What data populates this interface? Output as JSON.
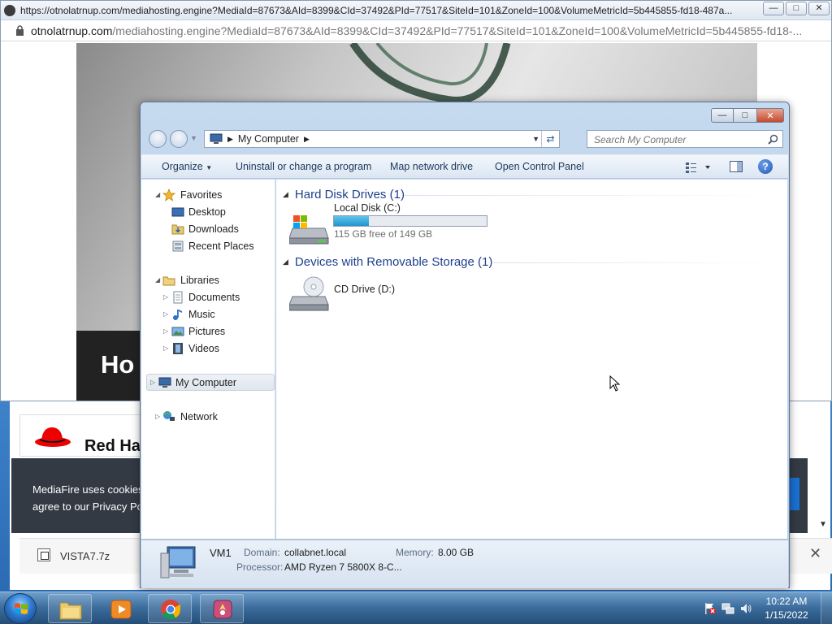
{
  "popup": {
    "title": "https://otnolatrnup.com/mediahosting.engine?MediaId=87673&AId=8399&CId=37492&PId=77517&SiteId=101&ZoneId=100&VolumeMetricId=5b445855-fd18-487a...",
    "url_host": "otnolatrnup.com",
    "url_rest": "/mediahosting.engine?MediaId=87673&AId=8399&CId=37492&PId=77517&SiteId=101&ZoneId=100&VolumeMetricId=5b445855-fd18-...",
    "banner_text": "Ho"
  },
  "underpage": {
    "redhat_text": "Red Ha",
    "cookie_line1": "MediaFire uses cookies",
    "cookie_line2": "agree to our Privacy Po",
    "download_name": "VISTA7.7z"
  },
  "explorer": {
    "address": "My Computer",
    "search_placeholder": "Search My Computer",
    "toolbar": {
      "organize": "Organize",
      "uninstall": "Uninstall or change a program",
      "map_drive": "Map network drive",
      "control_panel": "Open Control Panel"
    },
    "nav": {
      "favorites": "Favorites",
      "desktop": "Desktop",
      "downloads": "Downloads",
      "recent": "Recent Places",
      "libraries": "Libraries",
      "documents": "Documents",
      "music": "Music",
      "pictures": "Pictures",
      "videos": "Videos",
      "computer": "My Computer",
      "network": "Network"
    },
    "groups": {
      "hdd_header": "Hard Disk Drives (1)",
      "removable_header": "Devices with Removable Storage (1)"
    },
    "drives": {
      "c_name": "Local Disk (C:)",
      "c_free": "115 GB free of 149 GB",
      "c_used_fraction": 0.228,
      "d_name": "CD Drive (D:)"
    },
    "details": {
      "name": "VM1",
      "domain_label": "Domain:",
      "domain_value": "collabnet.local",
      "memory_label": "Memory:",
      "memory_value": "8.00 GB",
      "processor_label": "Processor:",
      "processor_value": "AMD Ryzen 7 5800X 8-C..."
    }
  },
  "taskbar": {
    "time": "10:22 AM",
    "date": "1/15/2022"
  },
  "colors": {
    "accent": "#1e3f8c",
    "taskbar": "#3e6f9e"
  }
}
